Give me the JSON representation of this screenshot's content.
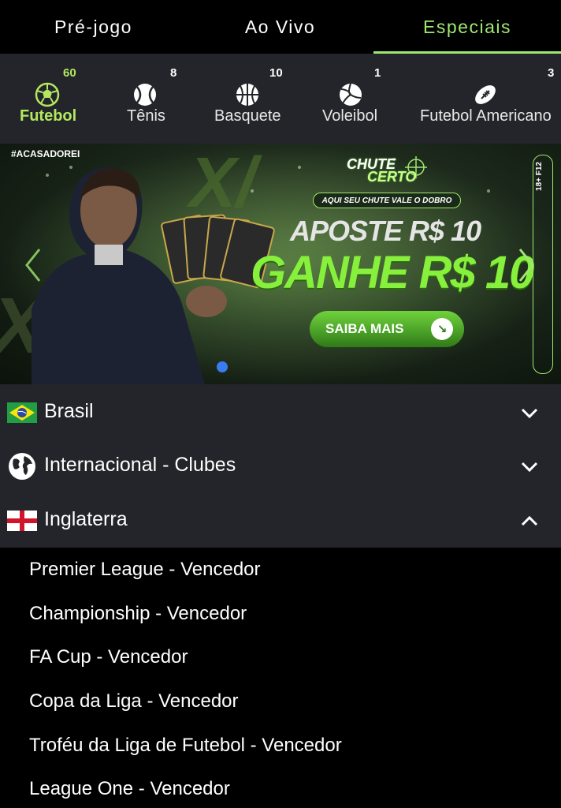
{
  "top_tabs": [
    {
      "label": "Pré-jogo",
      "active": false
    },
    {
      "label": "Ao Vivo",
      "active": false
    },
    {
      "label": "Especiais",
      "active": true
    }
  ],
  "sports": [
    {
      "count": "60",
      "label": "Futebol",
      "icon": "soccer-ball-icon",
      "active": true
    },
    {
      "count": "8",
      "label": "Tênis",
      "icon": "tennis-ball-icon",
      "active": false
    },
    {
      "count": "10",
      "label": "Basquete",
      "icon": "basketball-icon",
      "active": false
    },
    {
      "count": "1",
      "label": "Voleibol",
      "icon": "volleyball-icon",
      "active": false
    },
    {
      "count": "3",
      "label": "Futebol Americano",
      "icon": "american-football-icon",
      "active": false
    }
  ],
  "banner": {
    "hashtag": "#ACASADOREI",
    "brand_line1": "CHUTE",
    "brand_line2": "CERTO",
    "subtitle": "AQUI SEU CHUTE VALE O DOBRO",
    "headline1": "APOSTE R$ 10",
    "headline2": "GANHE R$ 10",
    "cta": "SAIBA MAIS",
    "age_badge": "18+  F12"
  },
  "groups": [
    {
      "label": "Brasil",
      "flag": "brazil-flag-icon",
      "expanded": false
    },
    {
      "label": "Internacional - Clubes",
      "flag": "globe-icon",
      "expanded": false
    },
    {
      "label": "Inglaterra",
      "flag": "england-flag-icon",
      "expanded": true
    }
  ],
  "leagues": [
    "Premier League - Vencedor",
    "Championship - Vencedor",
    "FA Cup - Vencedor",
    "Copa da Liga - Vencedor",
    "Troféu da Liga de Futebol - Vencedor",
    "League One - Vencedor"
  ],
  "colors": {
    "accent": "#9fe870",
    "active_sport": "#b3e85f",
    "panel": "#23252a",
    "background": "#000000",
    "carousel_dot": "#3a7cf0"
  }
}
